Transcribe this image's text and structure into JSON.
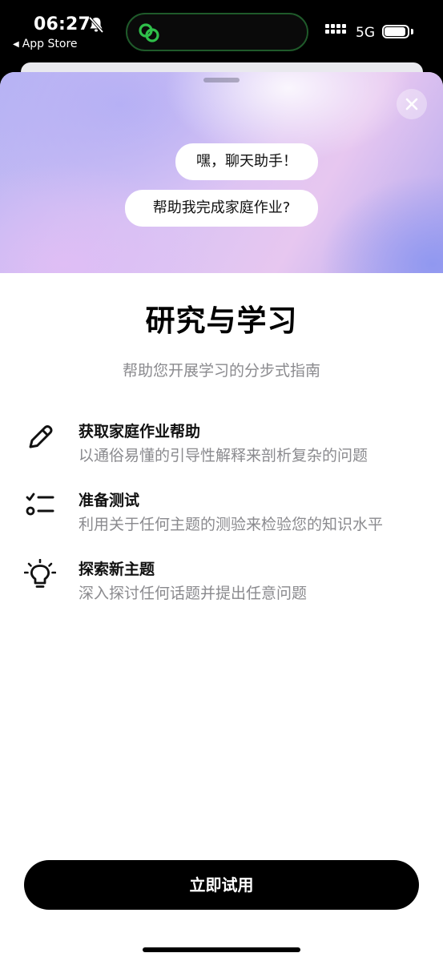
{
  "status_bar": {
    "time": "06:27",
    "back_app": "App Store",
    "network": "5G",
    "island_color": "#2fbf4a"
  },
  "sheet": {
    "chat_bubbles": [
      "嘿，聊天助手！",
      "帮助我完成家庭作业?"
    ],
    "title": "研究与学习",
    "subtitle": "帮助您开展学习的分步式指南",
    "features": [
      {
        "icon": "pencil-icon",
        "title": "获取家庭作业帮助",
        "description": "以通俗易懂的引导性解释来剖析复杂的问题"
      },
      {
        "icon": "checklist-icon",
        "title": "准备测试",
        "description": "利用关于任何主题的测验来检验您的知识水平"
      },
      {
        "icon": "lightbulb-icon",
        "title": "探索新主题",
        "description": "深入探讨任何话题并提出任意问题"
      }
    ],
    "cta_label": "立即试用"
  }
}
